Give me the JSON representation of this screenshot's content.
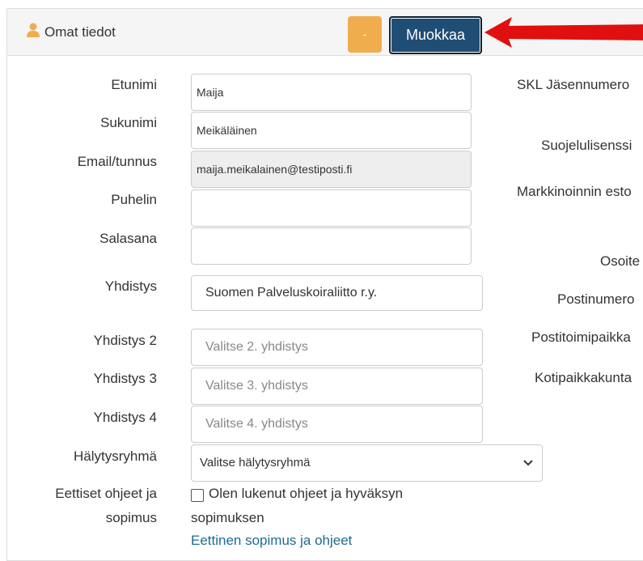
{
  "header": {
    "title": "Omat tiedot",
    "minus_label": "-",
    "edit_label": "Muokkaa"
  },
  "fields": [
    {
      "label": "Etunimi",
      "value": "Maija"
    },
    {
      "label": "Sukunimi",
      "value": "Meikäläinen"
    },
    {
      "label": "Email/tunnus",
      "value": "maija.meikalainen@testiposti.fi"
    },
    {
      "label": "Puhelin",
      "value": ""
    },
    {
      "label": "Salasana",
      "value": ""
    },
    {
      "label": "Yhdistys",
      "value": "Suomen Palveluskoiraliitto r.y."
    },
    {
      "label": "Yhdistys 2",
      "placeholder": "Valitse 2. yhdistys"
    },
    {
      "label": "Yhdistys 3",
      "placeholder": "Valitse 3. yhdistys"
    },
    {
      "label": "Yhdistys 4",
      "placeholder": "Valitse 4. yhdistys"
    }
  ],
  "alarm": {
    "label": "Hälytysryhmä",
    "selected": "Valitse hälytysryhmä"
  },
  "ethics": {
    "label_line1": "Eettiset ohjeet ja",
    "label_line2": "sopimus",
    "checkbox_line1": "Olen lukenut ohjeet ja hyväksyn",
    "checkbox_line2": "sopimuksen",
    "link": "Eettinen sopimus ja ohjeet"
  },
  "right_labels": [
    "SKL Jäsennumero",
    "Suojelulisenssi",
    "Markkinoinnin esto",
    "Osoite",
    "Postinumero",
    "Postitoimipaikka",
    "Kotipaikkakunta"
  ],
  "colors": {
    "edit_button": "#204d74",
    "minus_button": "#f0ad4e",
    "arrow": "#e01010",
    "link": "#1f6b8e"
  }
}
